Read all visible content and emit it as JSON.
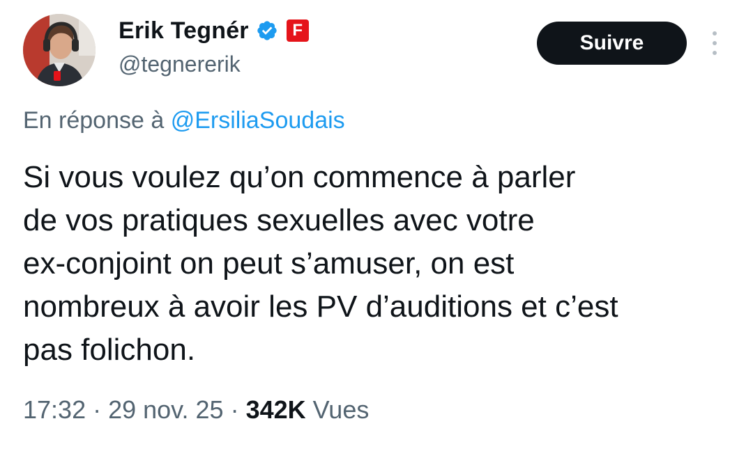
{
  "author": {
    "display_name": "Erik Tegnér",
    "handle": "@tegnererik",
    "verified_icon": "verified-badge-icon",
    "affiliate_badge_text": "F",
    "affiliate_color": "#e5141a"
  },
  "actions": {
    "follow_label": "Suivre",
    "more_icon": "more-vertical-icon"
  },
  "reply": {
    "prefix": "En réponse à",
    "mention": "@ErsiliaSoudais"
  },
  "tweet": {
    "lines": [
      "Si vous voulez qu’on commence à parler",
      "de vos pratiques sexuelles avec votre",
      "ex-conjoint on peut s’amuser, on est",
      "nombreux à avoir les PV d’auditions et c’est",
      "pas folichon."
    ]
  },
  "meta": {
    "time": "17:32",
    "separator": "·",
    "date": "29 nov. 25",
    "views_count": "342K",
    "views_label": "Vues"
  },
  "colors": {
    "text": "#0f1419",
    "secondary": "#536471",
    "link": "#1d9bf0",
    "verified": "#1d9bf0",
    "button_bg": "#0f1419"
  }
}
